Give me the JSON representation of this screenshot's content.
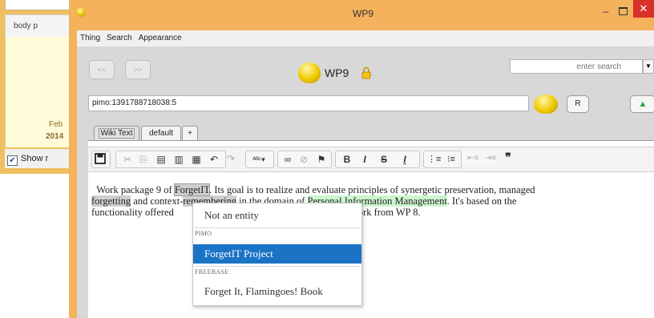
{
  "background_window": {
    "breadcrumbs": "body  p",
    "calendar_month": "Feb",
    "calendar_year": "2014",
    "show_checkbox_label": "Show r"
  },
  "window": {
    "title": "WP9",
    "minimize": "–",
    "close": "✕"
  },
  "menu": {
    "items": [
      "Thing",
      "Search",
      "Appearance"
    ]
  },
  "nav": {
    "back_label": "<<",
    "forward_label": ">>",
    "page_title": "WP9",
    "search_placeholder": "enter search"
  },
  "uri": {
    "value": "pimo:1391788718038:5",
    "r_button": "R",
    "up_icon": "▲"
  },
  "tabs": [
    {
      "label": "Wiki Text"
    },
    {
      "label": "default"
    },
    {
      "label": "+"
    }
  ],
  "toolbar": {
    "icons": [
      "save-icon",
      "cut-icon",
      "copy-icon",
      "paste-icon",
      "paste-text-icon",
      "paste-word-icon",
      "undo-icon",
      "redo-icon",
      "spellcheck-icon",
      "link-icon",
      "unlink-icon",
      "anchor-icon",
      "bold-icon",
      "italic-icon",
      "strike-icon",
      "remove-format-icon",
      "numbered-list-icon",
      "bulleted-list-icon",
      "outdent-icon",
      "indent-icon",
      "blockquote-icon"
    ]
  },
  "content": {
    "line1_a": "Work package 9 of ",
    "entity_forgetit": "ForgetIT",
    "line1_b": ". Its goal is to realize and evaluate principles of synergetic preservation, managed",
    "entity_forgetting": "forgetting",
    "line2_a": " and conte",
    "line2_hidden_a": "xt",
    "line2_b": "-",
    "entity_remembering": "remembering",
    "line2_c": " in the domain of ",
    "entity_pim": "Personal Information Management",
    "line2_d": ". It's based on the",
    "line3_a": "functionality offered",
    "line3_b": "ork from WP 8."
  },
  "popup": {
    "not_entity": "Not an entity",
    "header_pimo": "PIMO",
    "pimo_item": "ForgetIT   Project",
    "header_freebase": "FREEBASE",
    "freebase_item": "Forget It, Flamingoes!   Book"
  },
  "colors": {
    "window_frame": "#f4b25d",
    "close_button": "#d9302a",
    "selection": "#1a73c5",
    "entity_green": "#ccf5cf",
    "entity_grey": "#cfcfcf"
  }
}
